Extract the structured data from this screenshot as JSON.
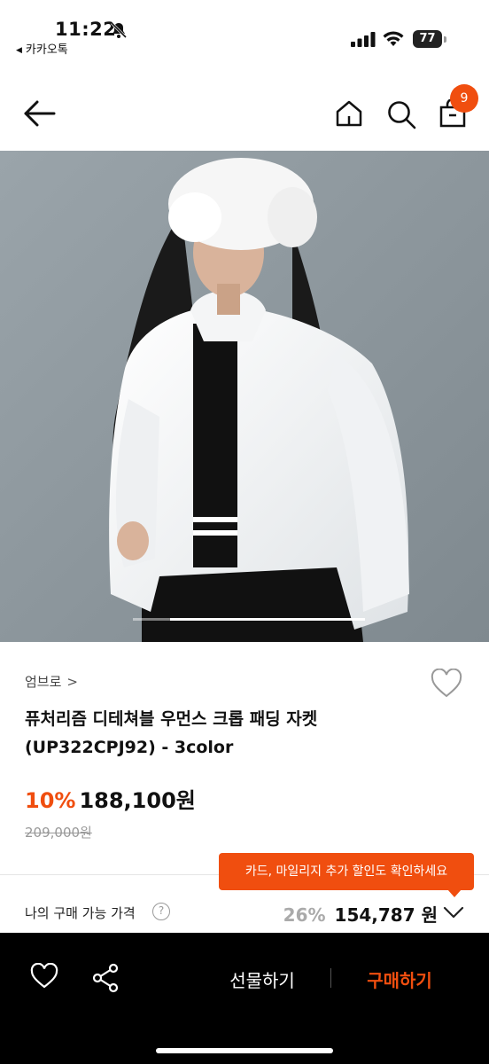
{
  "status_bar": {
    "time": "11:22",
    "back_app": "카카오톡",
    "battery": "77"
  },
  "nav": {
    "cart_count": "9"
  },
  "product": {
    "brand": "엄브로",
    "brand_chevron": ">",
    "title_line1": "퓨처리즘 디테쳐블 우먼스 크롭 패딩 자켓",
    "title_line2": "(UP322CPJ92) - 3color",
    "discount": "10%",
    "price": "188,100원",
    "original_price": "209,000원"
  },
  "tooltip": {
    "text": "카드, 마일리지 추가 할인도 확인하세요"
  },
  "my_price": {
    "label": "나의 구매 가능 가격",
    "help": "?",
    "percent": "26%",
    "price": "154,787 원"
  },
  "bottom_bar": {
    "gift_label": "선물하기",
    "buy_label": "구매하기"
  },
  "colors": {
    "accent": "#f04e0f",
    "bottom_bar_bg": "#000000"
  },
  "icons": [
    "bell-slash-icon",
    "signal-icon",
    "wifi-icon",
    "battery-icon",
    "back-arrow-icon",
    "home-icon",
    "search-icon",
    "shopping-bag-icon",
    "heart-icon",
    "share-icon",
    "chevron-down-icon",
    "question-icon"
  ]
}
